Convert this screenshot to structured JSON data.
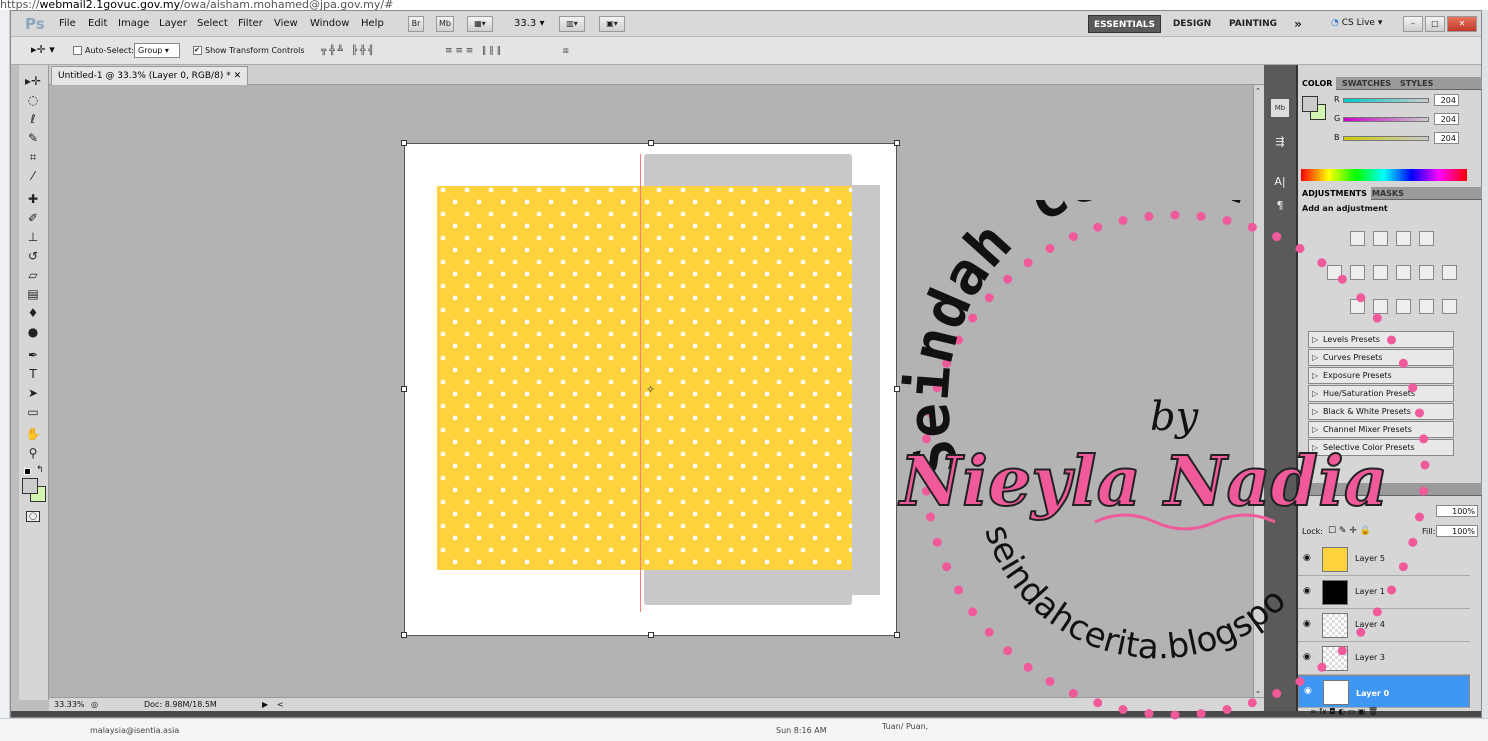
{
  "browser": {
    "url_prefix": "https://",
    "url_host": "webmail2.1govuc.gov.my",
    "url_path": "/owa/aisham.mohamed@jpa.gov.my/#"
  },
  "menubar": {
    "logo": "Ps",
    "items": [
      "File",
      "Edit",
      "Image",
      "Layer",
      "Select",
      "Filter",
      "View",
      "Window",
      "Help"
    ],
    "bridge": "Br",
    "minibridge": "Mb",
    "zoom": "33.3",
    "workspaces": [
      "ESSENTIALS",
      "DESIGN",
      "PAINTING"
    ],
    "more": "»",
    "cslive": "CS Live",
    "window_buttons": [
      "–",
      "□",
      "✕"
    ]
  },
  "options": {
    "auto_select_label": "Auto-Select:",
    "auto_select_value": "Group",
    "transform_label": "Show Transform Controls"
  },
  "document": {
    "tab_title": "Untitled-1 @ 33.3% (Layer 0, RGB/8) *",
    "tab_close": "✕",
    "zoom_status": "33.33%",
    "doc_status": "Doc: 8.98M/18.5M"
  },
  "colors": {
    "pattern_yellow": "#fdd33d",
    "selected_layer": "#3f97f3",
    "watermark_pink": "#f05a9b"
  },
  "tools": [
    "move-icon",
    "marquee-icon",
    "lasso-icon",
    "quick-select-icon",
    "crop-icon",
    "eyedropper-icon",
    "spot-heal-icon",
    "brush-icon",
    "stamp-icon",
    "history-brush-icon",
    "eraser-icon",
    "gradient-icon",
    "blur-icon",
    "dodge-icon",
    "pen-icon",
    "type-icon",
    "path-select-icon",
    "shape-icon",
    "hand-icon",
    "zoom-icon"
  ],
  "color_panel": {
    "tabs": [
      "COLOR",
      "SWATCHES",
      "STYLES"
    ],
    "channels": [
      {
        "label": "R",
        "value": "204"
      },
      {
        "label": "G",
        "value": "204"
      },
      {
        "label": "B",
        "value": "204"
      }
    ]
  },
  "adjustments_panel": {
    "tabs": [
      "ADJUSTMENTS",
      "MASKS"
    ],
    "heading": "Add an adjustment",
    "presets": [
      "Levels Presets",
      "Curves Presets",
      "Exposure Presets",
      "Hue/Saturation Presets",
      "Black & White Presets",
      "Channel Mixer Presets",
      "Selective Color Presets"
    ]
  },
  "layers_panel": {
    "opacity": "100%",
    "lock_label": "Lock:",
    "fill_label": "Fill:",
    "fill_value": "100%",
    "layers": [
      {
        "name": "Layer 5",
        "thumb": "#fdd33d",
        "selected": false
      },
      {
        "name": "Layer 1",
        "thumb": "#000000",
        "selected": false
      },
      {
        "name": "Layer 4",
        "thumb": "checker",
        "selected": false
      },
      {
        "name": "Layer 3",
        "thumb": "checker",
        "selected": false
      },
      {
        "name": "Layer 0",
        "thumb": "#ffffff",
        "selected": true
      }
    ]
  },
  "watermark": {
    "arc": "Seindah cerita",
    "by": "by",
    "name": "Nieyla Nadia",
    "url": "seindahcerita.blogspot.com"
  },
  "background": {
    "email": "malaysia@isentia.asia",
    "time": "Sun 8:16 AM",
    "snippet": "Tuan/ Puan,"
  }
}
